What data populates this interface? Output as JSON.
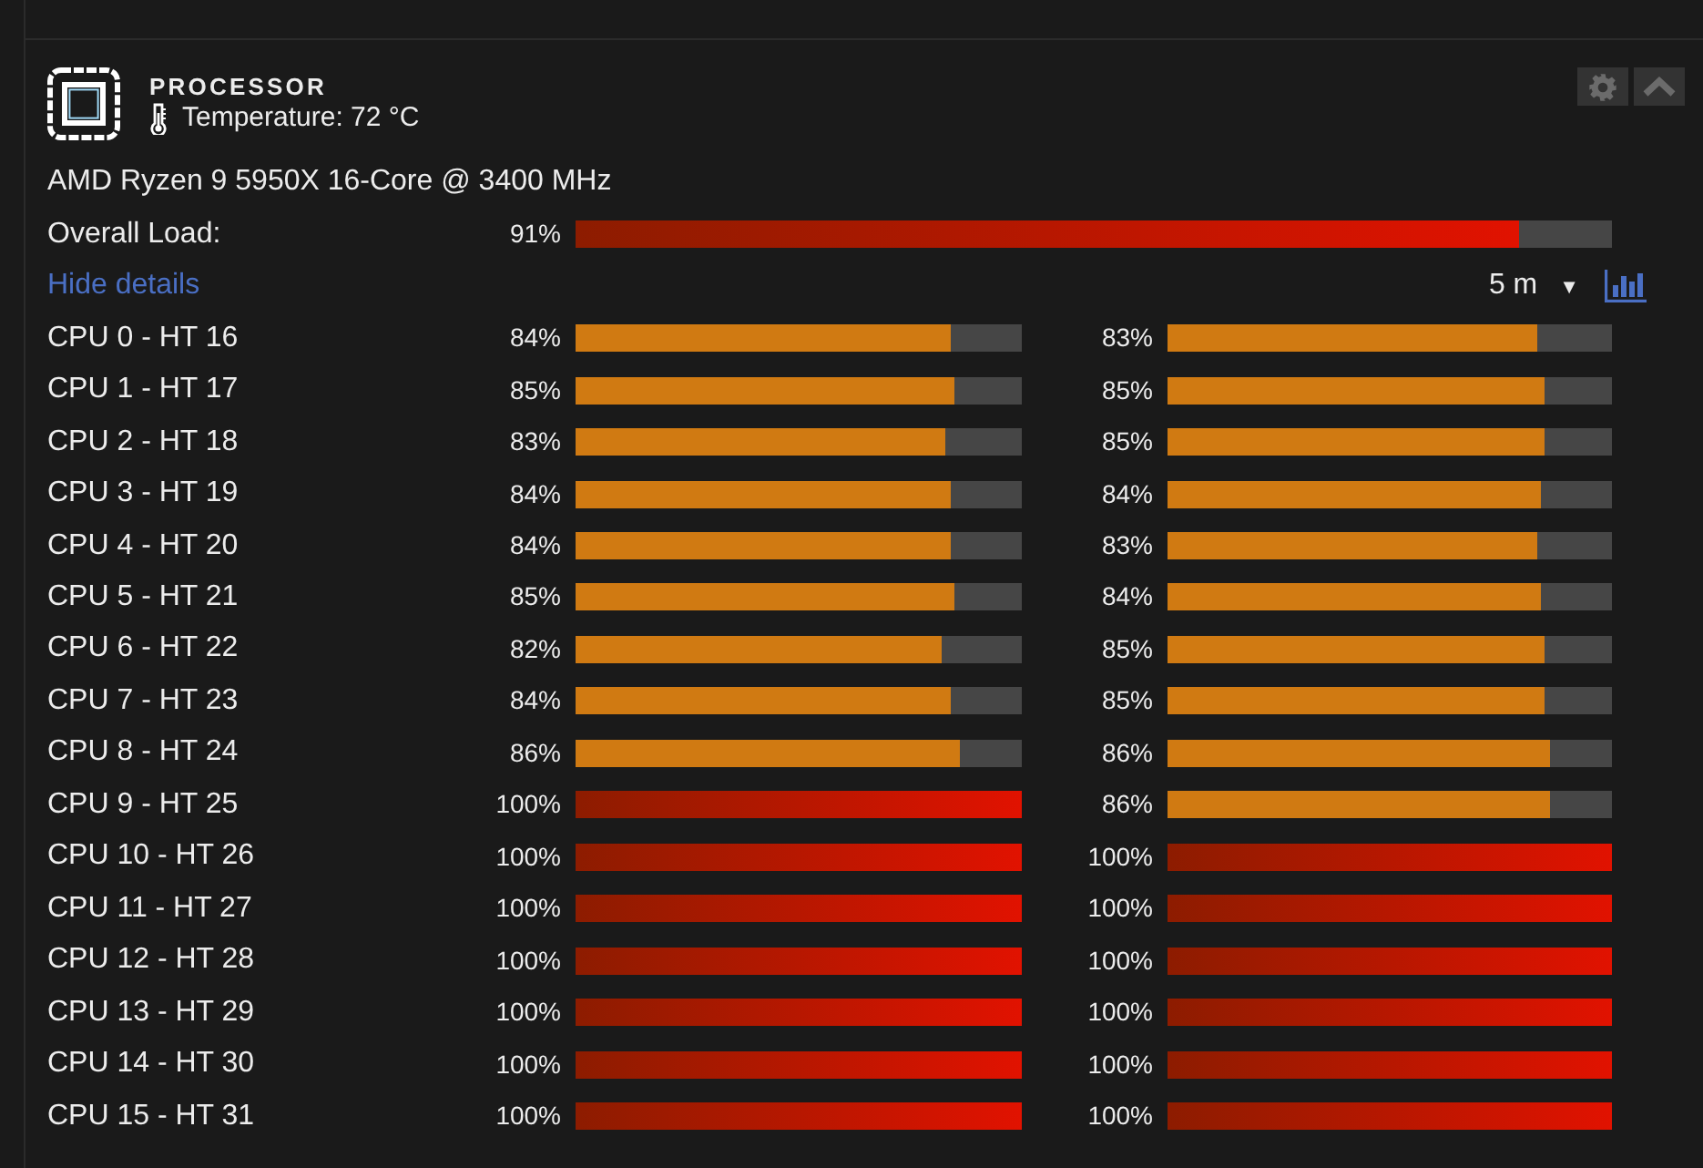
{
  "panel": {
    "title": "PROCESSOR",
    "temperature": "Temperature: 72 °C",
    "model": "AMD Ryzen 9 5950X 16-Core @ 3400 MHz",
    "overall": {
      "label": "Overall Load:",
      "reading": "91%",
      "level": 0.91
    },
    "details_link": "Hide details",
    "time_range": {
      "value": "5 m",
      "caret": "▼"
    },
    "cores": [
      {
        "label": "CPU 0 - HT 16",
        "threads": [
          {
            "reading": "84%",
            "level": 0.84
          },
          {
            "reading": "83%",
            "level": 0.83
          }
        ]
      },
      {
        "label": "CPU 1 - HT 17",
        "threads": [
          {
            "reading": "85%",
            "level": 0.85
          },
          {
            "reading": "85%",
            "level": 0.85
          }
        ]
      },
      {
        "label": "CPU 2 - HT 18",
        "threads": [
          {
            "reading": "83%",
            "level": 0.83
          },
          {
            "reading": "85%",
            "level": 0.85
          }
        ]
      },
      {
        "label": "CPU 3 - HT 19",
        "threads": [
          {
            "reading": "84%",
            "level": 0.84
          },
          {
            "reading": "84%",
            "level": 0.84
          }
        ]
      },
      {
        "label": "CPU 4 - HT 20",
        "threads": [
          {
            "reading": "84%",
            "level": 0.84
          },
          {
            "reading": "83%",
            "level": 0.83
          }
        ]
      },
      {
        "label": "CPU 5 - HT 21",
        "threads": [
          {
            "reading": "85%",
            "level": 0.85
          },
          {
            "reading": "84%",
            "level": 0.84
          }
        ]
      },
      {
        "label": "CPU 6 - HT 22",
        "threads": [
          {
            "reading": "82%",
            "level": 0.82
          },
          {
            "reading": "85%",
            "level": 0.85
          }
        ]
      },
      {
        "label": "CPU 7 - HT 23",
        "threads": [
          {
            "reading": "84%",
            "level": 0.84
          },
          {
            "reading": "85%",
            "level": 0.85
          }
        ]
      },
      {
        "label": "CPU 8 - HT 24",
        "threads": [
          {
            "reading": "86%",
            "level": 0.86
          },
          {
            "reading": "86%",
            "level": 0.86
          }
        ]
      },
      {
        "label": "CPU 9 - HT 25",
        "threads": [
          {
            "reading": "100%",
            "level": 1
          },
          {
            "reading": "86%",
            "level": 0.86
          }
        ]
      },
      {
        "label": "CPU 10 - HT 26",
        "threads": [
          {
            "reading": "100%",
            "level": 1
          },
          {
            "reading": "100%",
            "level": 1
          }
        ]
      },
      {
        "label": "CPU 11 - HT 27",
        "threads": [
          {
            "reading": "100%",
            "level": 1
          },
          {
            "reading": "100%",
            "level": 1
          }
        ]
      },
      {
        "label": "CPU 12 - HT 28",
        "threads": [
          {
            "reading": "100%",
            "level": 1
          },
          {
            "reading": "100%",
            "level": 1
          }
        ]
      },
      {
        "label": "CPU 13 - HT 29",
        "threads": [
          {
            "reading": "100%",
            "level": 1
          },
          {
            "reading": "100%",
            "level": 1
          }
        ]
      },
      {
        "label": "CPU 14 - HT 30",
        "threads": [
          {
            "reading": "100%",
            "level": 1
          },
          {
            "reading": "100%",
            "level": 1
          }
        ]
      },
      {
        "label": "CPU 15 - HT 31",
        "threads": [
          {
            "reading": "100%",
            "level": 1
          },
          {
            "reading": "100%",
            "level": 1
          }
        ]
      }
    ]
  }
}
